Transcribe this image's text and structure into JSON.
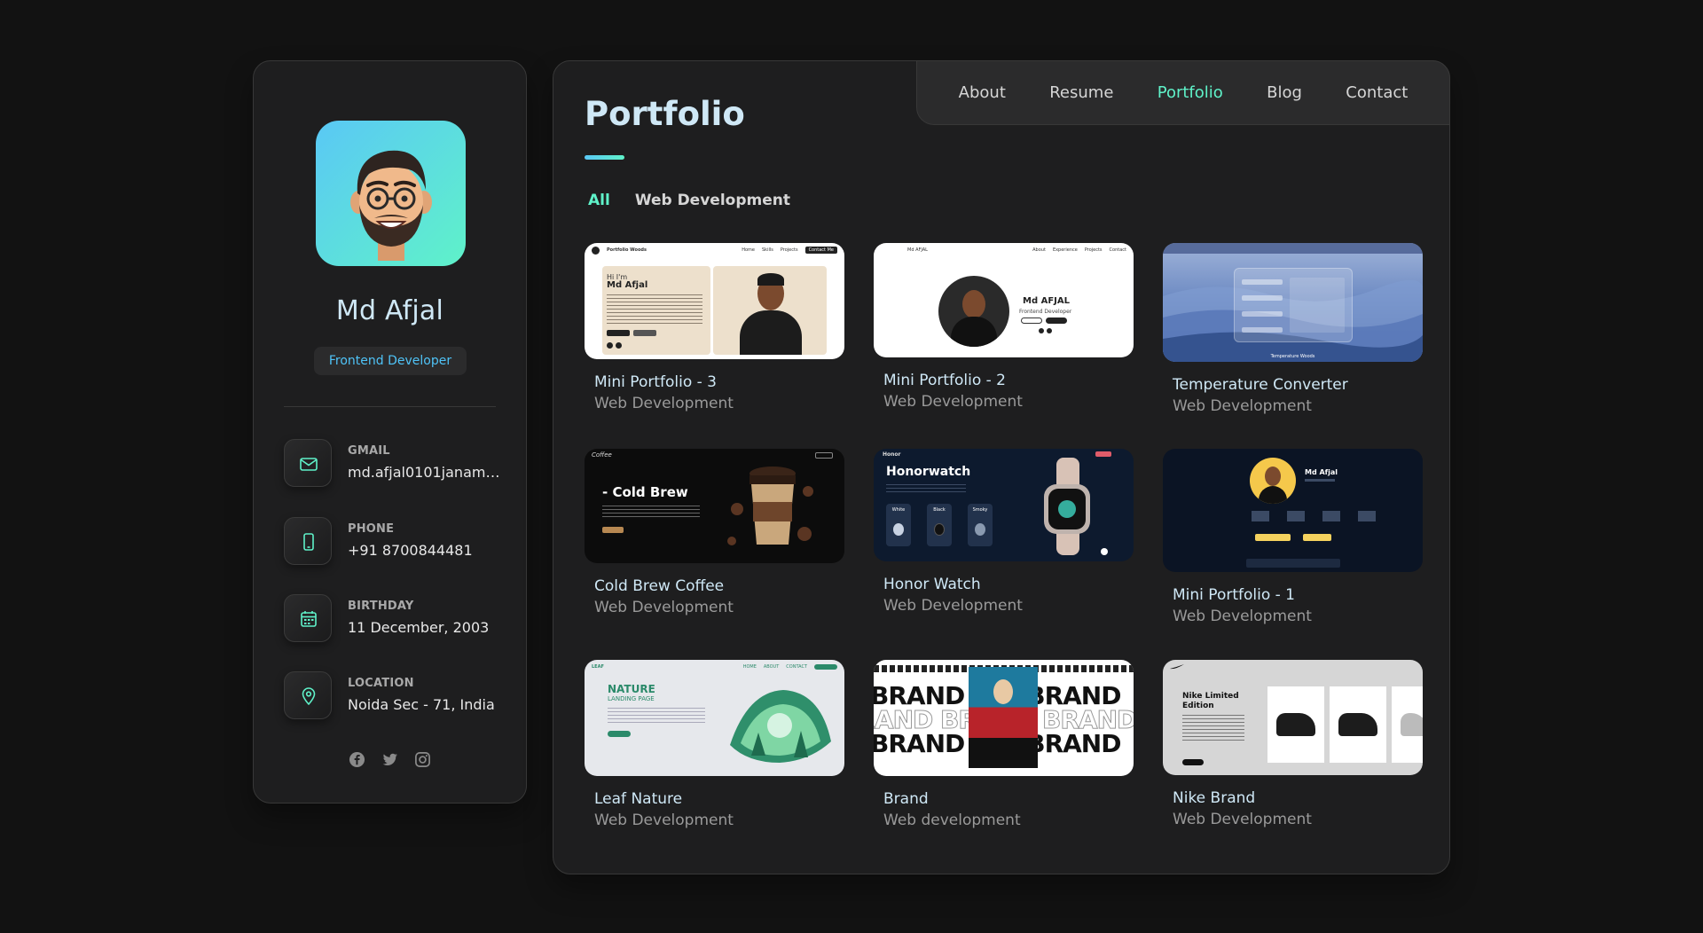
{
  "profile": {
    "name": "Md Afjal",
    "title": "Frontend Developer",
    "contacts": [
      {
        "label": "GMAIL",
        "value": "md.afjal0101janam@...",
        "icon": "mail-icon"
      },
      {
        "label": "PHONE",
        "value": "+91 8700844481",
        "icon": "phone-icon"
      },
      {
        "label": "BIRTHDAY",
        "value": "11 December, 2003",
        "icon": "calendar-icon"
      },
      {
        "label": "LOCATION",
        "value": "Noida Sec - 71, India",
        "icon": "location-pin-icon"
      }
    ],
    "socials": [
      "facebook-icon",
      "twitter-icon",
      "instagram-icon"
    ]
  },
  "nav": {
    "items": [
      "About",
      "Resume",
      "Portfolio",
      "Blog",
      "Contact"
    ],
    "active": "Portfolio"
  },
  "page": {
    "title": "Portfolio",
    "filters": [
      "All",
      "Web Development"
    ],
    "active_filter": "All"
  },
  "projects": [
    {
      "title": "Mini Portfolio - 3",
      "category": "Web Development",
      "thumb": {
        "brand": "Portfolio Woods",
        "greeting": "Hi I'm",
        "name": "Md Afjal",
        "nav": [
          "Home",
          "Skills",
          "Projects"
        ],
        "cta": "Contact Me"
      }
    },
    {
      "title": "Mini Portfolio - 2",
      "category": "Web Development",
      "thumb": {
        "brand": "Md AFJAL",
        "name": "Md AFJAL",
        "role": "Frontend Developer",
        "nav": [
          "About",
          "Experience",
          "Projects",
          "Contact"
        ]
      }
    },
    {
      "title": "Temperature Converter",
      "category": "Web Development",
      "thumb": {
        "caption": "Temperature Woods"
      }
    },
    {
      "title": "Cold Brew Coffee",
      "category": "Web Development",
      "thumb": {
        "brand": "Coffee",
        "headline": "- Cold Brew"
      }
    },
    {
      "title": "Honor Watch",
      "category": "Web Development",
      "thumb": {
        "brand": "Honor",
        "headline": "Honorwatch",
        "options": [
          "White",
          "Black",
          "Smoky"
        ]
      }
    },
    {
      "title": "Mini Portfolio - 1",
      "category": "Web Development",
      "thumb": {
        "name": "Md Afjal"
      }
    },
    {
      "title": "Leaf Nature",
      "category": "Web Development",
      "thumb": {
        "brand": "LEAF",
        "headline": "NATURE",
        "sub": "LANDING PAGE",
        "nav": [
          "HOME",
          "ABOUT",
          "CONTACT"
        ]
      }
    },
    {
      "title": "Brand",
      "category": "Web development",
      "thumb": {
        "word": "BRAND"
      }
    },
    {
      "title": "Nike Brand",
      "category": "Web Development",
      "thumb": {
        "headline": "Nike Limited Edition"
      }
    }
  ],
  "colors": {
    "accent": "#5ff2c9",
    "accent_blue": "#5ac8f5",
    "title": "#cfe8f6",
    "muted": "#9a9a9a",
    "card_bg": "#1e1e1f"
  }
}
